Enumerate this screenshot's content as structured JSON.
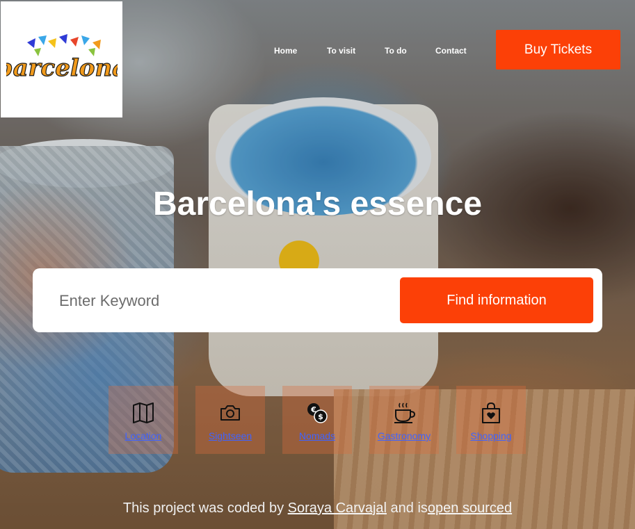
{
  "header": {
    "logo_text": "barcelona",
    "nav": [
      {
        "label": "Home"
      },
      {
        "label": "To visit"
      },
      {
        "label": "To do"
      },
      {
        "label": "Contact"
      }
    ],
    "buy_label": "Buy Tickets"
  },
  "hero": {
    "title": "Barcelona's essence"
  },
  "search": {
    "placeholder": "Enter Keyword",
    "button_label": "Find information"
  },
  "categories": [
    {
      "label": "Location",
      "icon": "map-icon"
    },
    {
      "label": "Sightseen",
      "icon": "camera-icon"
    },
    {
      "label": "Nomads",
      "icon": "coins-icon"
    },
    {
      "label": "Gastronomy",
      "icon": "coffee-cup-icon"
    },
    {
      "label": "Shopping",
      "icon": "shopping-bag-icon"
    }
  ],
  "footer": {
    "prefix": "This project was coded by",
    "author": "Soraya Carvajal",
    "middle": "and is",
    "link": "open sourced"
  },
  "colors": {
    "accent": "#fc4007",
    "link": "#3f63ff"
  }
}
